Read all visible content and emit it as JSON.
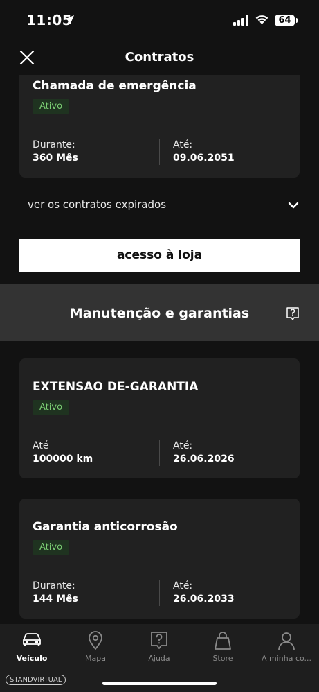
{
  "status_bar": {
    "time": "11:05",
    "battery": "64"
  },
  "header": {
    "title": "Contratos"
  },
  "contracts": [
    {
      "title": "Chamada de emergência",
      "status": "Ativo",
      "left_label": "Durante:",
      "left_value": "360 Mês",
      "right_label": "Até:",
      "right_value": "09.06.2051"
    }
  ],
  "expired": {
    "label": "ver os contratos expirados"
  },
  "store_button": {
    "label": "acesso à loja"
  },
  "maintenance": {
    "title": "Manutenção e garantias",
    "cards": [
      {
        "title": "EXTENSAO DE-GARANTIA",
        "status": "Ativo",
        "left_label": "Até",
        "left_value": "100000 km",
        "right_label": "Até:",
        "right_value": "26.06.2026"
      },
      {
        "title": "Garantia anticorrosão",
        "status": "Ativo",
        "left_label": "Durante:",
        "left_value": "144 Mês",
        "right_label": "Até:",
        "right_value": "26.06.2033"
      }
    ]
  },
  "tabs": [
    {
      "label": "Veículo",
      "icon": "car-icon",
      "active": true
    },
    {
      "label": "Mapa",
      "icon": "map-pin-icon",
      "active": false
    },
    {
      "label": "Ajuda",
      "icon": "help-icon",
      "active": false
    },
    {
      "label": "Store",
      "icon": "shopping-bag-icon",
      "active": false
    },
    {
      "label": "A minha co...",
      "icon": "user-icon",
      "active": false
    }
  ],
  "watermark": {
    "text": "STANDVIRTUAL"
  },
  "colors": {
    "background": "#121212",
    "card": "#212121",
    "section": "#333333",
    "badge_text": "#7ccf74",
    "badge_bg": "#1f3320"
  }
}
